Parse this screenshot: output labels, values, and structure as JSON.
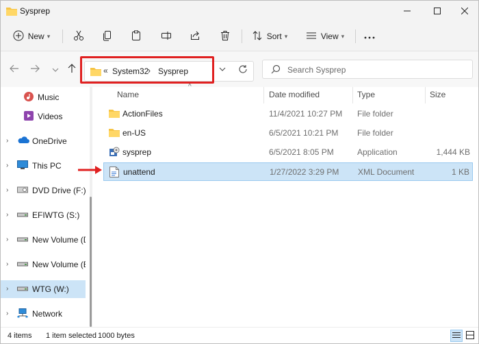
{
  "window": {
    "title": "Sysprep"
  },
  "toolbar": {
    "new_label": "New",
    "sort_label": "Sort",
    "view_label": "View"
  },
  "address": {
    "overflow_glyph": "«",
    "crumbs": [
      "System32",
      "Sysprep"
    ],
    "separator": "›"
  },
  "search": {
    "placeholder": "Search Sysprep"
  },
  "sidebar": {
    "items": [
      {
        "label": "Music",
        "icon": "music-icon"
      },
      {
        "label": "Videos",
        "icon": "videos-icon"
      },
      {
        "label": "OneDrive",
        "icon": "cloud-icon"
      },
      {
        "label": "This PC",
        "icon": "pc-icon"
      },
      {
        "label": "DVD Drive (F:) CC",
        "icon": "dvd-icon"
      },
      {
        "label": "EFIWTG (S:)",
        "icon": "drive-icon"
      },
      {
        "label": "New Volume (D:)",
        "icon": "drive-icon"
      },
      {
        "label": "New Volume (E:)",
        "icon": "drive-icon"
      },
      {
        "label": "WTG (W:)",
        "icon": "drive-icon"
      },
      {
        "label": "Network",
        "icon": "network-icon"
      }
    ]
  },
  "columns": {
    "name": "Name",
    "date": "Date modified",
    "type": "Type",
    "size": "Size"
  },
  "files": [
    {
      "name": "ActionFiles",
      "date": "11/4/2021 10:27 PM",
      "type": "File folder",
      "size": ""
    },
    {
      "name": "en-US",
      "date": "6/5/2021 10:21 PM",
      "type": "File folder",
      "size": ""
    },
    {
      "name": "sysprep",
      "date": "6/5/2021 8:05 PM",
      "type": "Application",
      "size": "1,444 KB"
    },
    {
      "name": "unattend",
      "date": "1/27/2022 3:29 PM",
      "type": "XML Document",
      "size": "1 KB"
    }
  ],
  "status": {
    "items_count": "4 items",
    "selection": "1 item selected",
    "selection_size": "1000 bytes"
  },
  "colors": {
    "accent_selection": "#cce4f7",
    "highlight_red": "#e02020",
    "folder": "#f6c445"
  }
}
